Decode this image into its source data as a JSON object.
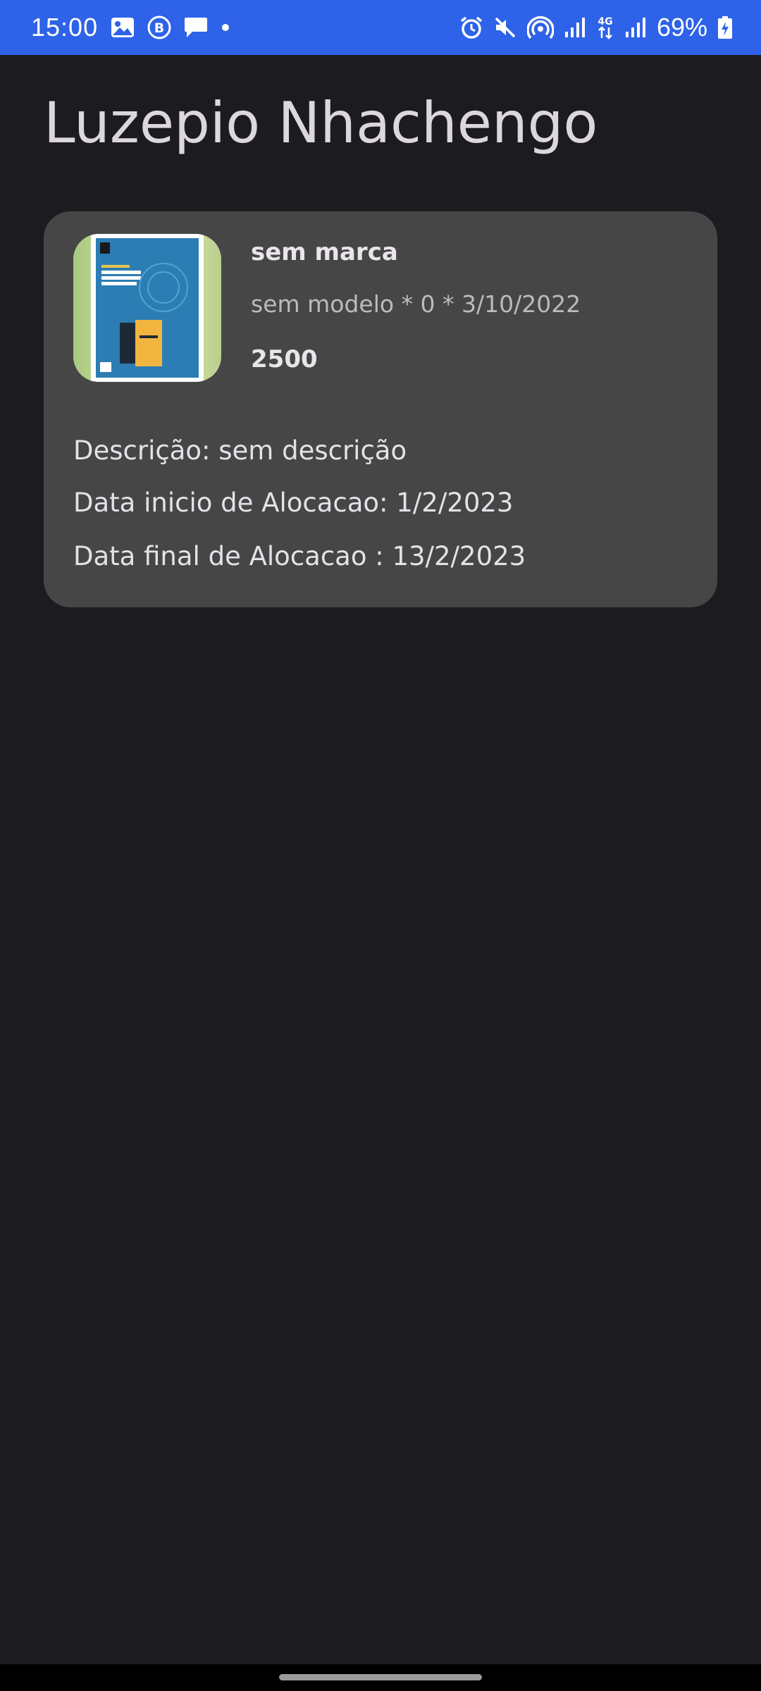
{
  "status_bar": {
    "time": "15:00",
    "battery": "69%",
    "left_icons": [
      "gallery-icon",
      "b-badge-icon",
      "message-icon",
      "dot-icon"
    ],
    "right_icons": [
      "alarm-icon",
      "mute-icon",
      "hotspot-icon",
      "signal-icon",
      "lte-4g-icon",
      "signal-2-icon",
      "battery-icon"
    ],
    "network_label": "4G"
  },
  "page": {
    "title": "Luzepio Nhachengo"
  },
  "card": {
    "brand": "sem marca",
    "model_line": "sem modelo  * 0 * 3/10/2022",
    "price": "2500",
    "description": "Descrição: sem descrição",
    "start_date": "Data inicio de Alocacao: 1/2/2023",
    "end_date": "Data final de Alocacao : 13/2/2023"
  },
  "colors": {
    "status_bar_bg": "#2e62e8",
    "background": "#1c1b20",
    "card_bg": "#464646"
  }
}
